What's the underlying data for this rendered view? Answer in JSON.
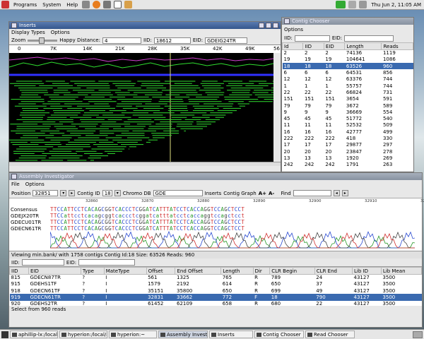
{
  "top_panel": {
    "menus": [
      "Programs",
      "System",
      "Help"
    ],
    "clock": "Thu Jun  2, 11:05 AM"
  },
  "inserts": {
    "title": "Inserts",
    "menus": [
      "Display Types",
      "Options"
    ],
    "zoom_label": "Zoom",
    "happy_distance_label": "Happy Distance:",
    "happy_distance_value": "4",
    "iid_label": "IID:",
    "iid_value": "18612",
    "eid_label": "EID:",
    "eid_value": "GDEIG24TR",
    "ruler": [
      "0",
      "7K",
      "14K",
      "21K",
      "28K",
      "35K",
      "42K",
      "49K",
      "56"
    ]
  },
  "contig_chooser": {
    "title": "Contig Chooser",
    "menus": [
      "Options"
    ],
    "iid_label": "IID:",
    "eid_label": "EID:",
    "columns": [
      "Id",
      "IID",
      "EID",
      "Length",
      "Reads"
    ],
    "rows": [
      [
        "2",
        "2",
        "2",
        "74136",
        "1119"
      ],
      [
        "19",
        "19",
        "19",
        "104641",
        "1086"
      ],
      [
        "18",
        "18",
        "18",
        "63526",
        "960"
      ],
      [
        "6",
        "6",
        "6",
        "64531",
        "856"
      ],
      [
        "12",
        "12",
        "12",
        "63376",
        "744"
      ],
      [
        "1",
        "1",
        "1",
        "55757",
        "744"
      ],
      [
        "22",
        "22",
        "22",
        "66824",
        "731"
      ],
      [
        "151",
        "151",
        "151",
        "3654",
        "591"
      ],
      [
        "79",
        "79",
        "79",
        "3672",
        "589"
      ],
      [
        "9",
        "9",
        "9",
        "36669",
        "554"
      ],
      [
        "45",
        "45",
        "45",
        "51772",
        "540"
      ],
      [
        "11",
        "11",
        "11",
        "52532",
        "509"
      ],
      [
        "16",
        "16",
        "16",
        "42777",
        "499"
      ],
      [
        "222",
        "222",
        "222",
        "418",
        "330"
      ],
      [
        "17",
        "17",
        "17",
        "29877",
        "297"
      ],
      [
        "20",
        "20",
        "20",
        "23847",
        "278"
      ],
      [
        "13",
        "13",
        "13",
        "1920",
        "269"
      ],
      [
        "242",
        "242",
        "242",
        "1791",
        "263"
      ]
    ],
    "selected_row": 2
  },
  "assembly": {
    "title": "Assembly Investigator",
    "menus": [
      "File",
      "Options"
    ],
    "position_label": "Position",
    "position_value": "32851",
    "contig_id_label": "Contig ID",
    "contig_id_value": "18",
    "chromo_db_label": "Chromo DB",
    "chromo_db_value": "GDE",
    "inserts_btn": "Inserts",
    "contig_graph_btn": "Contig Graph",
    "font_up": "A+",
    "font_down": "A-",
    "find_label": "Find",
    "ruler": [
      "32860",
      "32870",
      "32880",
      "32890",
      "32900",
      "32910",
      "32920"
    ],
    "consensus_label": "Consensus",
    "consensus_seq": "TTCCATTCCTCACAGCGGTCACCCTCGGATCATTTATCCTCACCAGGTCCAGCTCCT",
    "reads": [
      {
        "name": "GDEJX20TR",
        "seq": "TTCCattcctcacagcggtcaccctcggatcatttatcctcaccaggtccagctcct"
      },
      {
        "name": "GDECU01TR",
        "seq": "TTCCATTCCTCACAGCGGTCACCCTCGGATCATTTATCCTCACCAGGTCCAGCTCCT"
      },
      {
        "name": "GDECN61TR",
        "seq": "TTCCATTCCTCACAGCGGTCACCCTCGGATCATTTATCCTCACCAGGTCCAGCTCCT"
      }
    ],
    "status": "Viewing min.bank/ with 1758 contigs Contig Id:18 Size: 63526 Reads: 960",
    "iid_label": "IID:",
    "eid_label": "EID:",
    "columns": [
      "IID",
      "EID",
      "Type",
      "MateType",
      "Offset",
      "End Offset",
      "Length",
      "Dir",
      "CLR Begin",
      "CLR End",
      "Lib ID",
      "Lib Mean"
    ],
    "rows": [
      [
        "815",
        "GDECN87TR",
        "?",
        "I",
        "561",
        "1325",
        "765",
        "R",
        "789",
        "24",
        "43127",
        "3500"
      ],
      [
        "915",
        "GDEHS1TF",
        "?",
        "I",
        "1579",
        "2192",
        "614",
        "R",
        "650",
        "37",
        "43127",
        "3500"
      ],
      [
        "918",
        "GDECN61TF",
        "?",
        "I",
        "35151",
        "35800",
        "650",
        "R",
        "699",
        "49",
        "43127",
        "3500"
      ],
      [
        "919",
        "GDECN61TR",
        "?",
        "I",
        "32831",
        "33662",
        "772",
        "F",
        "18",
        "790",
        "43127",
        "3500"
      ],
      [
        "920",
        "GDEHS2TR",
        "?",
        "I",
        "61452",
        "62109",
        "658",
        "R",
        "680",
        "22",
        "43127",
        "3500"
      ]
    ],
    "selected_row": 3,
    "footer": "Select from 960 reads"
  },
  "taskbar": {
    "items": [
      "aphillip-lx:/local/a",
      "hyperion:/local/as",
      "hyperion:~",
      "Assembly Investig",
      "Inserts",
      "Contig Chooser",
      "Read Chooser"
    ],
    "active_index": 3
  }
}
